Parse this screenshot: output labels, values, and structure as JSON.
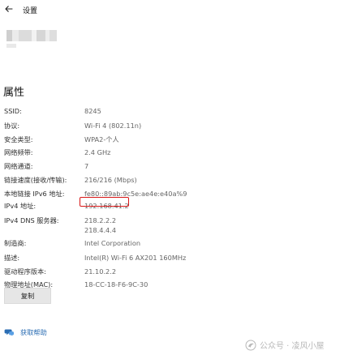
{
  "header": {
    "back_icon": "left-arrow-icon",
    "title": "设置"
  },
  "section": {
    "title": "属性"
  },
  "properties": [
    {
      "label": "SSID:",
      "value": "8245"
    },
    {
      "label": "协议:",
      "value": "Wi-Fi 4 (802.11n)"
    },
    {
      "label": "安全类型:",
      "value": "WPA2-个人"
    },
    {
      "label": "网络频带:",
      "value": "2.4 GHz"
    },
    {
      "label": "网络通道:",
      "value": "7"
    },
    {
      "label": "链接速度(接收/传输):",
      "value": "216/216 (Mbps)"
    },
    {
      "label": "本地链接 IPv6 地址:",
      "value": "fe80::89ab:9c5e:ae4e:e40a%9"
    },
    {
      "label": "IPv4 地址:",
      "value": "192.168.41.2"
    },
    {
      "label": "IPv4 DNS 服务器:",
      "values": [
        "218.2.2.2",
        "218.4.4.4"
      ]
    },
    {
      "label": "制造商:",
      "value": "Intel Corporation"
    },
    {
      "label": "描述:",
      "value": "Intel(R) Wi-Fi 6 AX201 160MHz"
    },
    {
      "label": "驱动程序版本:",
      "value": "21.10.2.2"
    },
    {
      "label": "物理地址(MAC):",
      "value": "18-CC-18-F6-9C-30"
    }
  ],
  "actions": {
    "copy_label": "复制"
  },
  "help": {
    "icon": "help-chat-icon",
    "label": "获取帮助"
  },
  "watermark": {
    "icon": "wechat-official-icon",
    "text": "公众号 · 凌风小屋"
  },
  "colors": {
    "highlight": "#d71515",
    "link": "#2b6db3"
  }
}
